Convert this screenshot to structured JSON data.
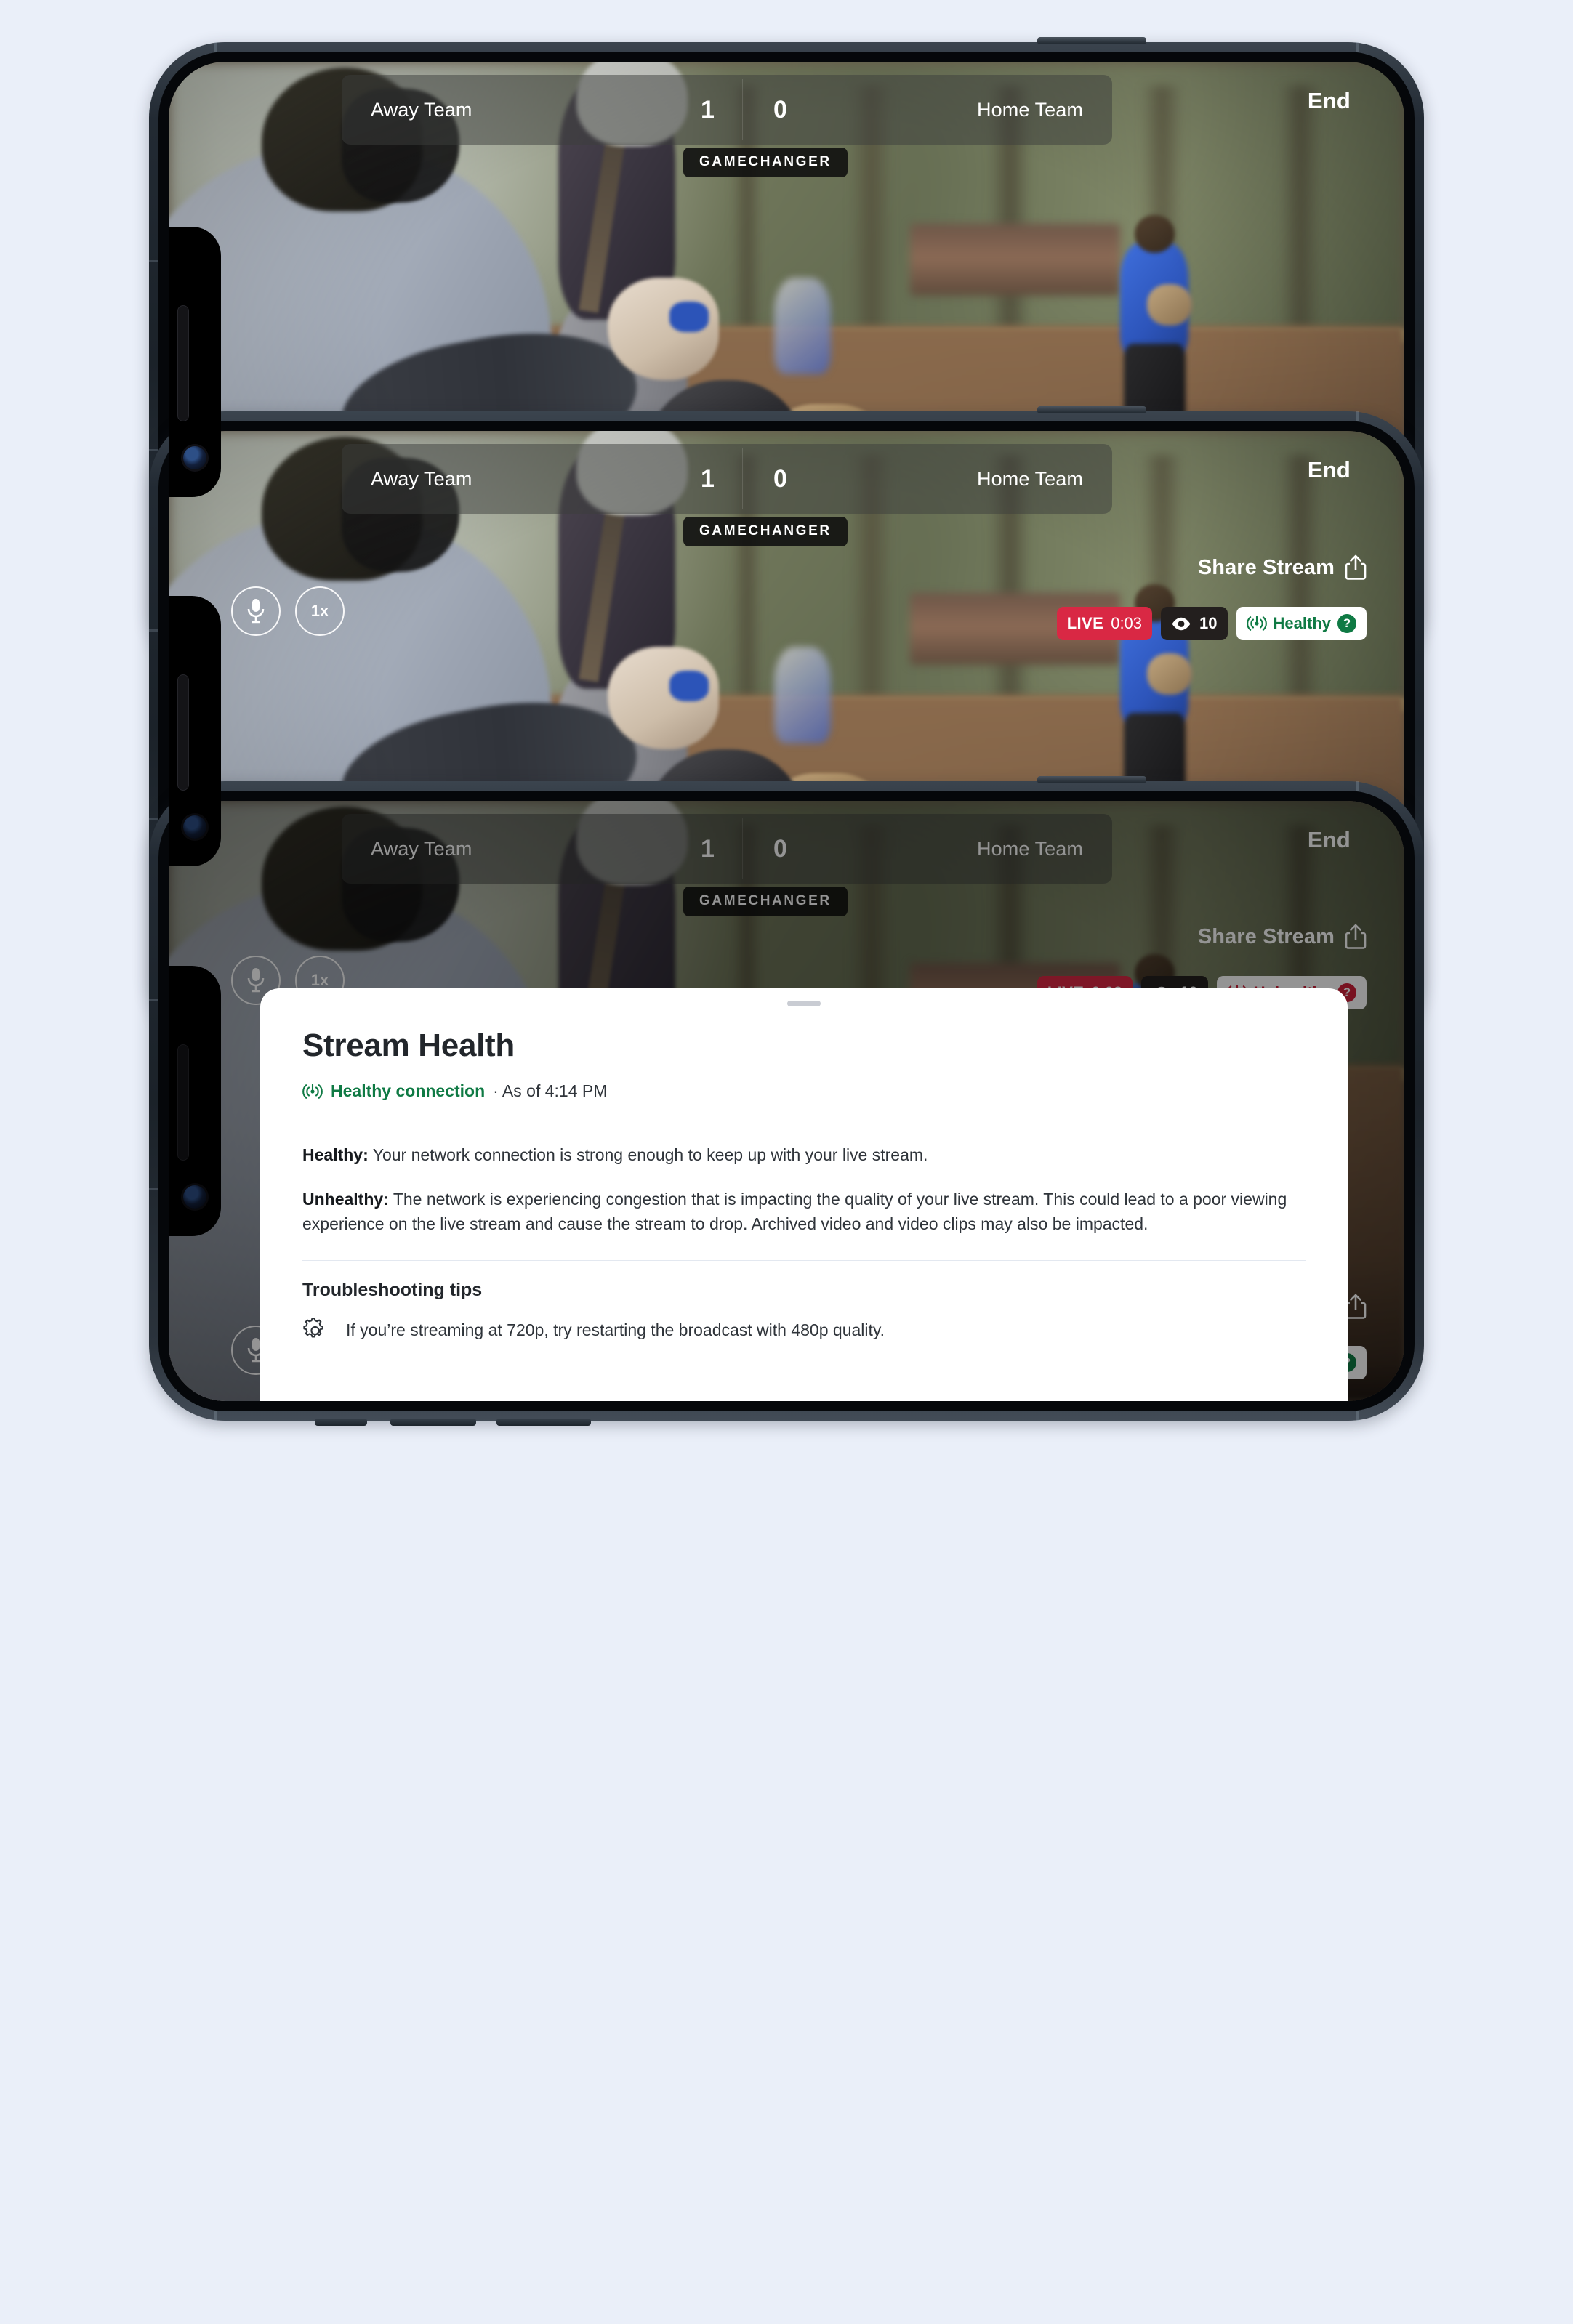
{
  "background_color": "#eaeff9",
  "scoreboard": {
    "away_team": "Away Team",
    "away_score": "1",
    "home_score": "0",
    "home_team": "Home Team",
    "end_label": "End",
    "brand_badge": "GAMECHANGER"
  },
  "controls": {
    "mic_icon": "microphone-icon",
    "zoom_label": "1x"
  },
  "share": {
    "label": "Share Stream",
    "icon": "share-upload-icon"
  },
  "status": {
    "live_label": "LIVE",
    "live_time": "0:03",
    "viewer_icon": "eye-icon",
    "viewer_count": "10",
    "health_icon": "broadcast-signal-icon",
    "help_icon": "question-mark-icon",
    "healthy_label": "Healthy",
    "unhealthy_label": "Unhealthy",
    "healthy_color": "#0f7a44",
    "unhealthy_color": "#cf2038",
    "live_color": "#d92844"
  },
  "sheet": {
    "grabber": "sheet-drag-handle",
    "title": "Stream Health",
    "connection_state": "Healthy connection",
    "connection_time": "· As of 4:14 PM",
    "healthy_label": "Healthy:",
    "healthy_text": " Your network connection is strong enough to keep up with your live stream.",
    "unhealthy_label": "Unhealthy:",
    "unhealthy_text": " The network is experiencing congestion that is impacting the quality of your live stream. This could lead to a poor viewing experience on the live stream and cause the stream to drop. Archived video and video clips may also be impacted.",
    "tips_title": "Troubleshooting tips",
    "tip_icon": "gear-icon",
    "tip_text": "If you’re streaming at 720p, try restarting the broadcast with 480p quality."
  }
}
